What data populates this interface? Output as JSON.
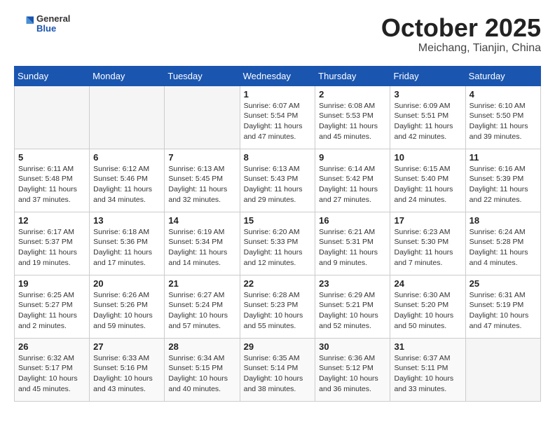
{
  "header": {
    "logo": {
      "general": "General",
      "blue": "Blue"
    },
    "title": "October 2025",
    "location": "Meichang, Tianjin, China"
  },
  "weekdays": [
    "Sunday",
    "Monday",
    "Tuesday",
    "Wednesday",
    "Thursday",
    "Friday",
    "Saturday"
  ],
  "weeks": [
    [
      {
        "day": "",
        "info": ""
      },
      {
        "day": "",
        "info": ""
      },
      {
        "day": "",
        "info": ""
      },
      {
        "day": "1",
        "info": "Sunrise: 6:07 AM\nSunset: 5:54 PM\nDaylight: 11 hours and 47 minutes."
      },
      {
        "day": "2",
        "info": "Sunrise: 6:08 AM\nSunset: 5:53 PM\nDaylight: 11 hours and 45 minutes."
      },
      {
        "day": "3",
        "info": "Sunrise: 6:09 AM\nSunset: 5:51 PM\nDaylight: 11 hours and 42 minutes."
      },
      {
        "day": "4",
        "info": "Sunrise: 6:10 AM\nSunset: 5:50 PM\nDaylight: 11 hours and 39 minutes."
      }
    ],
    [
      {
        "day": "5",
        "info": "Sunrise: 6:11 AM\nSunset: 5:48 PM\nDaylight: 11 hours and 37 minutes."
      },
      {
        "day": "6",
        "info": "Sunrise: 6:12 AM\nSunset: 5:46 PM\nDaylight: 11 hours and 34 minutes."
      },
      {
        "day": "7",
        "info": "Sunrise: 6:13 AM\nSunset: 5:45 PM\nDaylight: 11 hours and 32 minutes."
      },
      {
        "day": "8",
        "info": "Sunrise: 6:13 AM\nSunset: 5:43 PM\nDaylight: 11 hours and 29 minutes."
      },
      {
        "day": "9",
        "info": "Sunrise: 6:14 AM\nSunset: 5:42 PM\nDaylight: 11 hours and 27 minutes."
      },
      {
        "day": "10",
        "info": "Sunrise: 6:15 AM\nSunset: 5:40 PM\nDaylight: 11 hours and 24 minutes."
      },
      {
        "day": "11",
        "info": "Sunrise: 6:16 AM\nSunset: 5:39 PM\nDaylight: 11 hours and 22 minutes."
      }
    ],
    [
      {
        "day": "12",
        "info": "Sunrise: 6:17 AM\nSunset: 5:37 PM\nDaylight: 11 hours and 19 minutes."
      },
      {
        "day": "13",
        "info": "Sunrise: 6:18 AM\nSunset: 5:36 PM\nDaylight: 11 hours and 17 minutes."
      },
      {
        "day": "14",
        "info": "Sunrise: 6:19 AM\nSunset: 5:34 PM\nDaylight: 11 hours and 14 minutes."
      },
      {
        "day": "15",
        "info": "Sunrise: 6:20 AM\nSunset: 5:33 PM\nDaylight: 11 hours and 12 minutes."
      },
      {
        "day": "16",
        "info": "Sunrise: 6:21 AM\nSunset: 5:31 PM\nDaylight: 11 hours and 9 minutes."
      },
      {
        "day": "17",
        "info": "Sunrise: 6:23 AM\nSunset: 5:30 PM\nDaylight: 11 hours and 7 minutes."
      },
      {
        "day": "18",
        "info": "Sunrise: 6:24 AM\nSunset: 5:28 PM\nDaylight: 11 hours and 4 minutes."
      }
    ],
    [
      {
        "day": "19",
        "info": "Sunrise: 6:25 AM\nSunset: 5:27 PM\nDaylight: 11 hours and 2 minutes."
      },
      {
        "day": "20",
        "info": "Sunrise: 6:26 AM\nSunset: 5:26 PM\nDaylight: 10 hours and 59 minutes."
      },
      {
        "day": "21",
        "info": "Sunrise: 6:27 AM\nSunset: 5:24 PM\nDaylight: 10 hours and 57 minutes."
      },
      {
        "day": "22",
        "info": "Sunrise: 6:28 AM\nSunset: 5:23 PM\nDaylight: 10 hours and 55 minutes."
      },
      {
        "day": "23",
        "info": "Sunrise: 6:29 AM\nSunset: 5:21 PM\nDaylight: 10 hours and 52 minutes."
      },
      {
        "day": "24",
        "info": "Sunrise: 6:30 AM\nSunset: 5:20 PM\nDaylight: 10 hours and 50 minutes."
      },
      {
        "day": "25",
        "info": "Sunrise: 6:31 AM\nSunset: 5:19 PM\nDaylight: 10 hours and 47 minutes."
      }
    ],
    [
      {
        "day": "26",
        "info": "Sunrise: 6:32 AM\nSunset: 5:17 PM\nDaylight: 10 hours and 45 minutes."
      },
      {
        "day": "27",
        "info": "Sunrise: 6:33 AM\nSunset: 5:16 PM\nDaylight: 10 hours and 43 minutes."
      },
      {
        "day": "28",
        "info": "Sunrise: 6:34 AM\nSunset: 5:15 PM\nDaylight: 10 hours and 40 minutes."
      },
      {
        "day": "29",
        "info": "Sunrise: 6:35 AM\nSunset: 5:14 PM\nDaylight: 10 hours and 38 minutes."
      },
      {
        "day": "30",
        "info": "Sunrise: 6:36 AM\nSunset: 5:12 PM\nDaylight: 10 hours and 36 minutes."
      },
      {
        "day": "31",
        "info": "Sunrise: 6:37 AM\nSunset: 5:11 PM\nDaylight: 10 hours and 33 minutes."
      },
      {
        "day": "",
        "info": ""
      }
    ]
  ]
}
